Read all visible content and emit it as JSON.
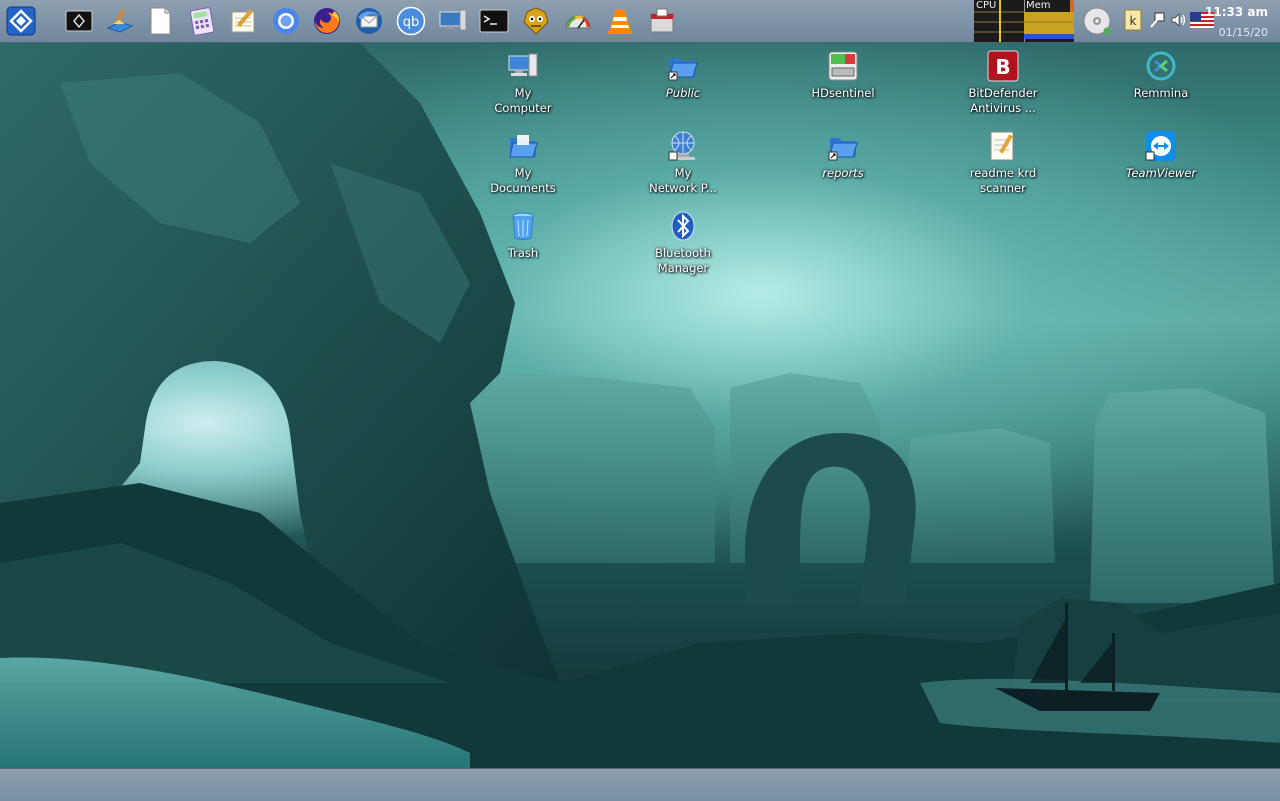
{
  "top_panel": {
    "launchers": [
      {
        "name": "start-menu-button-icon",
        "color": "#1f5fbf"
      },
      {
        "name": "screen-capture-icon",
        "color": "#222222"
      },
      {
        "name": "file-manager-icon",
        "color": "#3a8ae0"
      },
      {
        "name": "text-document-icon",
        "color": "#ffffff"
      },
      {
        "name": "calculator-icon",
        "color": "#9b6fd0"
      },
      {
        "name": "notepad-icon",
        "color": "#e8d7a0"
      },
      {
        "name": "chromium-icon",
        "color": "#4a86e8"
      },
      {
        "name": "firefox-icon",
        "color": "#ff7b16"
      },
      {
        "name": "thunderbird-icon",
        "color": "#2f6fbf"
      },
      {
        "name": "qbittorrent-icon",
        "color": "#3b7fd1"
      },
      {
        "name": "system-monitor-icon",
        "color": "#3a7ac0"
      },
      {
        "name": "terminal-icon",
        "color": "#111111"
      },
      {
        "name": "ghost-icon",
        "color": "#d9a41c"
      },
      {
        "name": "disk-speed-icon",
        "color": "#5caa3c"
      },
      {
        "name": "vlc-icon",
        "color": "#ff8800"
      },
      {
        "name": "package-installer-icon",
        "color": "#c8202a"
      }
    ],
    "sysmon": {
      "cpu_label": "CPU",
      "mem_label": "Mem"
    },
    "tray": [
      {
        "name": "optical-disc-icon"
      },
      {
        "name": "keyboard-k-icon"
      },
      {
        "name": "network-icon"
      },
      {
        "name": "volume-icon"
      },
      {
        "name": "us-flag-icon"
      }
    ],
    "clock": {
      "time": "11:33 am",
      "date": "01/15/20"
    }
  },
  "desktop": {
    "icons": [
      {
        "id": "my-computer",
        "label": "My\nComputer",
        "icon": "computer-icon",
        "italic": false
      },
      {
        "id": "public",
        "label": "Public",
        "icon": "folder-link-icon",
        "italic": true
      },
      {
        "id": "hdsentinel",
        "label": "HDsentinel",
        "icon": "hard-disk-icon",
        "italic": false
      },
      {
        "id": "bitdefender",
        "label": "BitDefender\nAntivirus ...",
        "icon": "bitdefender-icon",
        "italic": false
      },
      {
        "id": "remmina",
        "label": "Remmina",
        "icon": "remmina-icon",
        "italic": false
      },
      {
        "id": "my-documents",
        "label": "My\nDocuments",
        "icon": "folder-icon",
        "italic": false
      },
      {
        "id": "my-network",
        "label": "My\nNetwork P...",
        "icon": "network-globe-icon",
        "italic": false
      },
      {
        "id": "reports",
        "label": "reports",
        "icon": "folder-link-icon",
        "italic": true
      },
      {
        "id": "readme",
        "label": "readme krd\nscanner",
        "icon": "text-note-icon",
        "italic": false
      },
      {
        "id": "teamviewer",
        "label": "TeamViewer",
        "icon": "teamviewer-icon",
        "italic": true
      },
      {
        "id": "trash",
        "label": "Trash",
        "icon": "trash-icon",
        "italic": false
      },
      {
        "id": "bluetooth",
        "label": "Bluetooth\nManager",
        "icon": "bluetooth-icon",
        "italic": false
      }
    ]
  },
  "theme": {
    "panel": "#7f93a6",
    "desktop_accent": "#3f8c88"
  }
}
